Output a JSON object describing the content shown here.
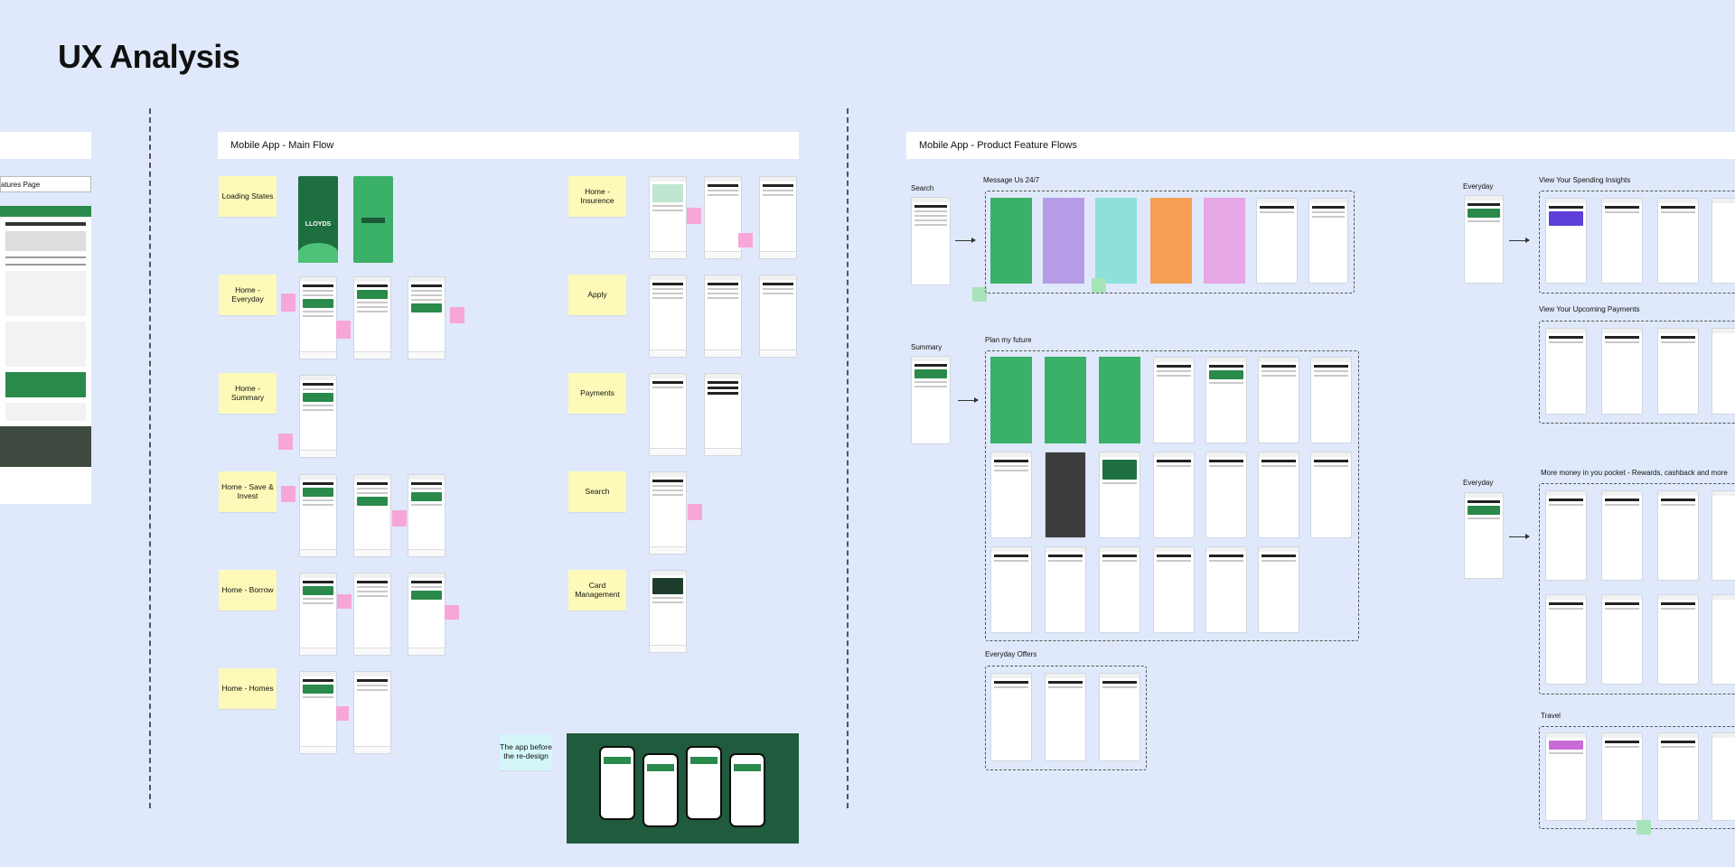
{
  "page_title": "UX Analysis",
  "sections": {
    "main_flow": "Mobile App - Main Flow",
    "feature_flows": "Mobile App - Product Feature Flows",
    "features_page": "atures Page"
  },
  "main_flow_stickies": [
    "Loading States",
    "Home - Everyday",
    "Home - Summary",
    "Home - Save & Invest",
    "Home - Borrow",
    "Home - Homes",
    "Home - Insurence",
    "Apply",
    "Payments",
    "Search",
    "Card Management"
  ],
  "before_redesign_note": "The app before the re-design",
  "flow_labels": {
    "search": "Search",
    "message_us": "Message Us 24/7",
    "summary": "Summary",
    "plan_future": "Plan my future",
    "everyday_offers": "Everyday Offers",
    "everyday_1": "Everyday",
    "spending_insights": "View Your Spending Insights",
    "upcoming_payments": "View Your Upcoming Payments",
    "everyday_2": "Everyday",
    "more_money": "More money in you pocket - Rewards, cashback and more",
    "travel": "Travel"
  },
  "splash_logo": "LLOYDS",
  "colors": {
    "background": "#dfe9fb",
    "sticky": "#fdfab9",
    "brand_green": "#2a8a4b",
    "promo_bg": "#1f5b3c"
  }
}
